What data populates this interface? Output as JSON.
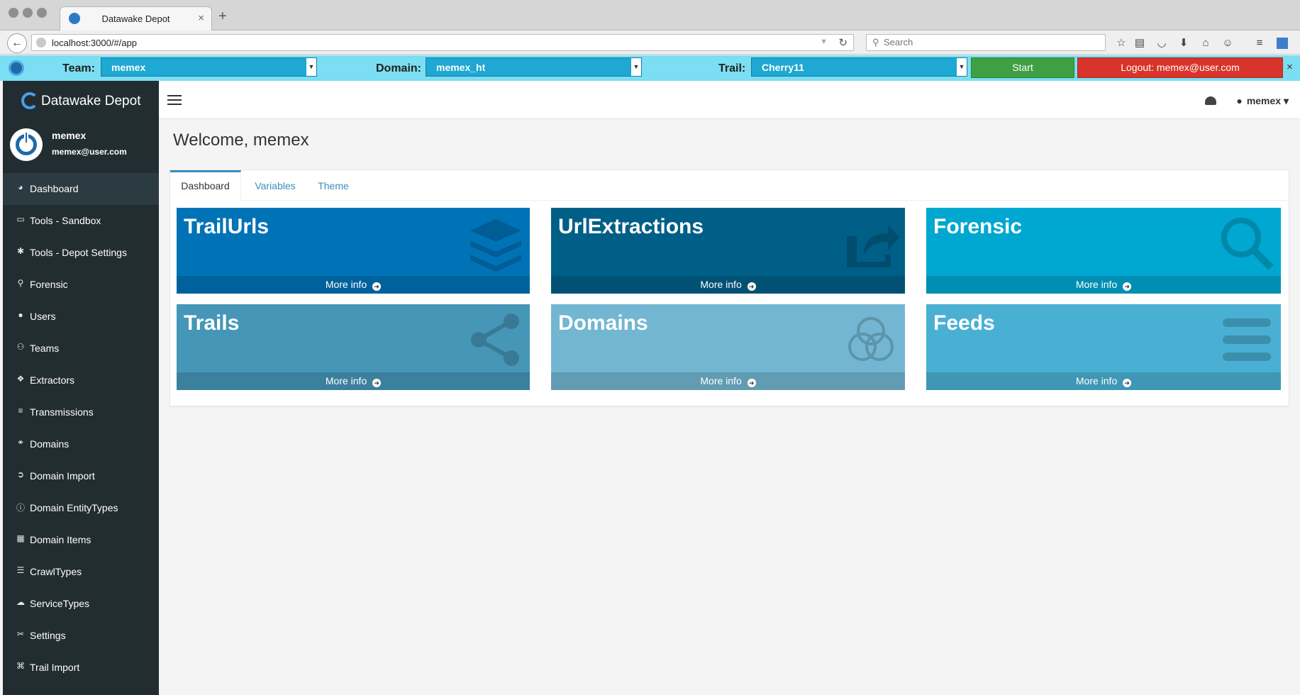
{
  "browser": {
    "tab_title": "Datawake Depot",
    "url": "localhost:3000/#/app",
    "search_placeholder": "Search"
  },
  "appbar": {
    "team_label": "Team:",
    "team_value": "memex",
    "domain_label": "Domain:",
    "domain_value": "memex_ht",
    "trail_label": "Trail:",
    "trail_value": "Cherry11",
    "start_label": "Start",
    "logout_label": "Logout: memex@user.com"
  },
  "sidebar": {
    "brand": "Datawake Depot",
    "user_name": "memex",
    "user_email": "memex@user.com",
    "items": [
      {
        "label": "Dashboard",
        "icon": "dashboard-icon",
        "glyph": "◕"
      },
      {
        "label": "Tools - Sandbox",
        "icon": "inbox-icon",
        "glyph": "▭"
      },
      {
        "label": "Tools - Depot Settings",
        "icon": "gear-icon",
        "glyph": "✱"
      },
      {
        "label": "Forensic",
        "icon": "search-icon",
        "glyph": "⚲"
      },
      {
        "label": "Users",
        "icon": "user-icon",
        "glyph": "●"
      },
      {
        "label": "Teams",
        "icon": "users-icon",
        "glyph": "⚇"
      },
      {
        "label": "Extractors",
        "icon": "cubes-icon",
        "glyph": "❖"
      },
      {
        "label": "Transmissions",
        "icon": "list-icon",
        "glyph": "≡"
      },
      {
        "label": "Domains",
        "icon": "circles-icon",
        "glyph": "⚭"
      },
      {
        "label": "Domain Import",
        "icon": "import-icon",
        "glyph": "➲"
      },
      {
        "label": "Domain EntityTypes",
        "icon": "info-icon",
        "glyph": "ⓘ"
      },
      {
        "label": "Domain Items",
        "icon": "grid-icon",
        "glyph": "▦"
      },
      {
        "label": "CrawlTypes",
        "icon": "sliders-icon",
        "glyph": "☰"
      },
      {
        "label": "ServiceTypes",
        "icon": "cloud-icon",
        "glyph": "☁"
      },
      {
        "label": "Settings",
        "icon": "wrench-icon",
        "glyph": "✂"
      },
      {
        "label": "Trail Import",
        "icon": "route-icon",
        "glyph": "⌘"
      }
    ]
  },
  "header": {
    "user_label": "memex"
  },
  "main": {
    "title": "Welcome, memex",
    "tabs": [
      "Dashboard",
      "Variables",
      "Theme"
    ],
    "more_info": "More info",
    "tiles": [
      {
        "title": "TrailUrls",
        "icon": "layers-icon",
        "color": "#0073b7"
      },
      {
        "title": "UrlExtractions",
        "icon": "share-square-icon",
        "color": "#005f87"
      },
      {
        "title": "Forensic",
        "icon": "search-icon",
        "color": "#00a7d0"
      },
      {
        "title": "Trails",
        "icon": "share-alt-icon",
        "color": "#4596b7"
      },
      {
        "title": "Domains",
        "icon": "circles-icon",
        "color": "#72b6d1"
      },
      {
        "title": "Feeds",
        "icon": "bars-icon",
        "color": "#4ab0d3"
      }
    ]
  }
}
